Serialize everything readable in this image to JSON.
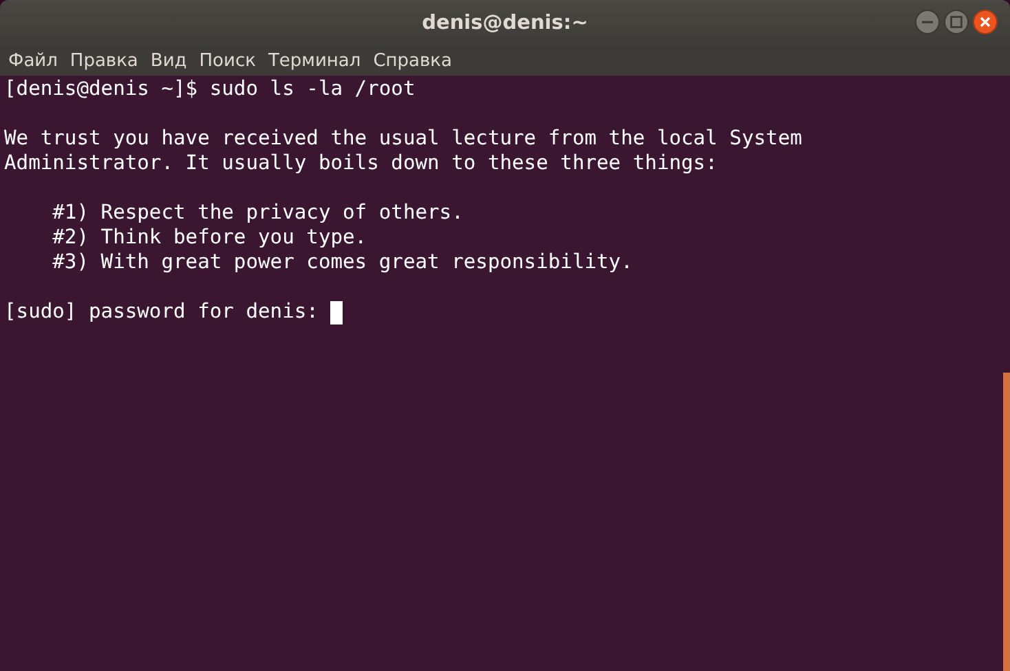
{
  "window": {
    "title": "denis@denis:~"
  },
  "menu": [
    "Файл",
    "Правка",
    "Вид",
    "Поиск",
    "Терминал",
    "Справка"
  ],
  "terminal": {
    "blocks": [
      {
        "lines": [
          {
            "text": "[denis@denis ~]$ sudo ls -la /root",
            "cursor": false
          }
        ]
      },
      {
        "lines": [
          {
            "text": "We trust you have received the usual lecture from the local System",
            "cursor": false
          },
          {
            "text": "Administrator. It usually boils down to these three things:",
            "cursor": false
          }
        ]
      },
      {
        "lines": [
          {
            "text": "    #1) Respect the privacy of others.",
            "cursor": false
          },
          {
            "text": "    #2) Think before you type.",
            "cursor": false
          },
          {
            "text": "    #3) With great power comes great responsibility.",
            "cursor": false
          }
        ]
      },
      {
        "lines": [
          {
            "text": "[sudo] password for denis: ",
            "cursor": true
          }
        ]
      }
    ]
  }
}
